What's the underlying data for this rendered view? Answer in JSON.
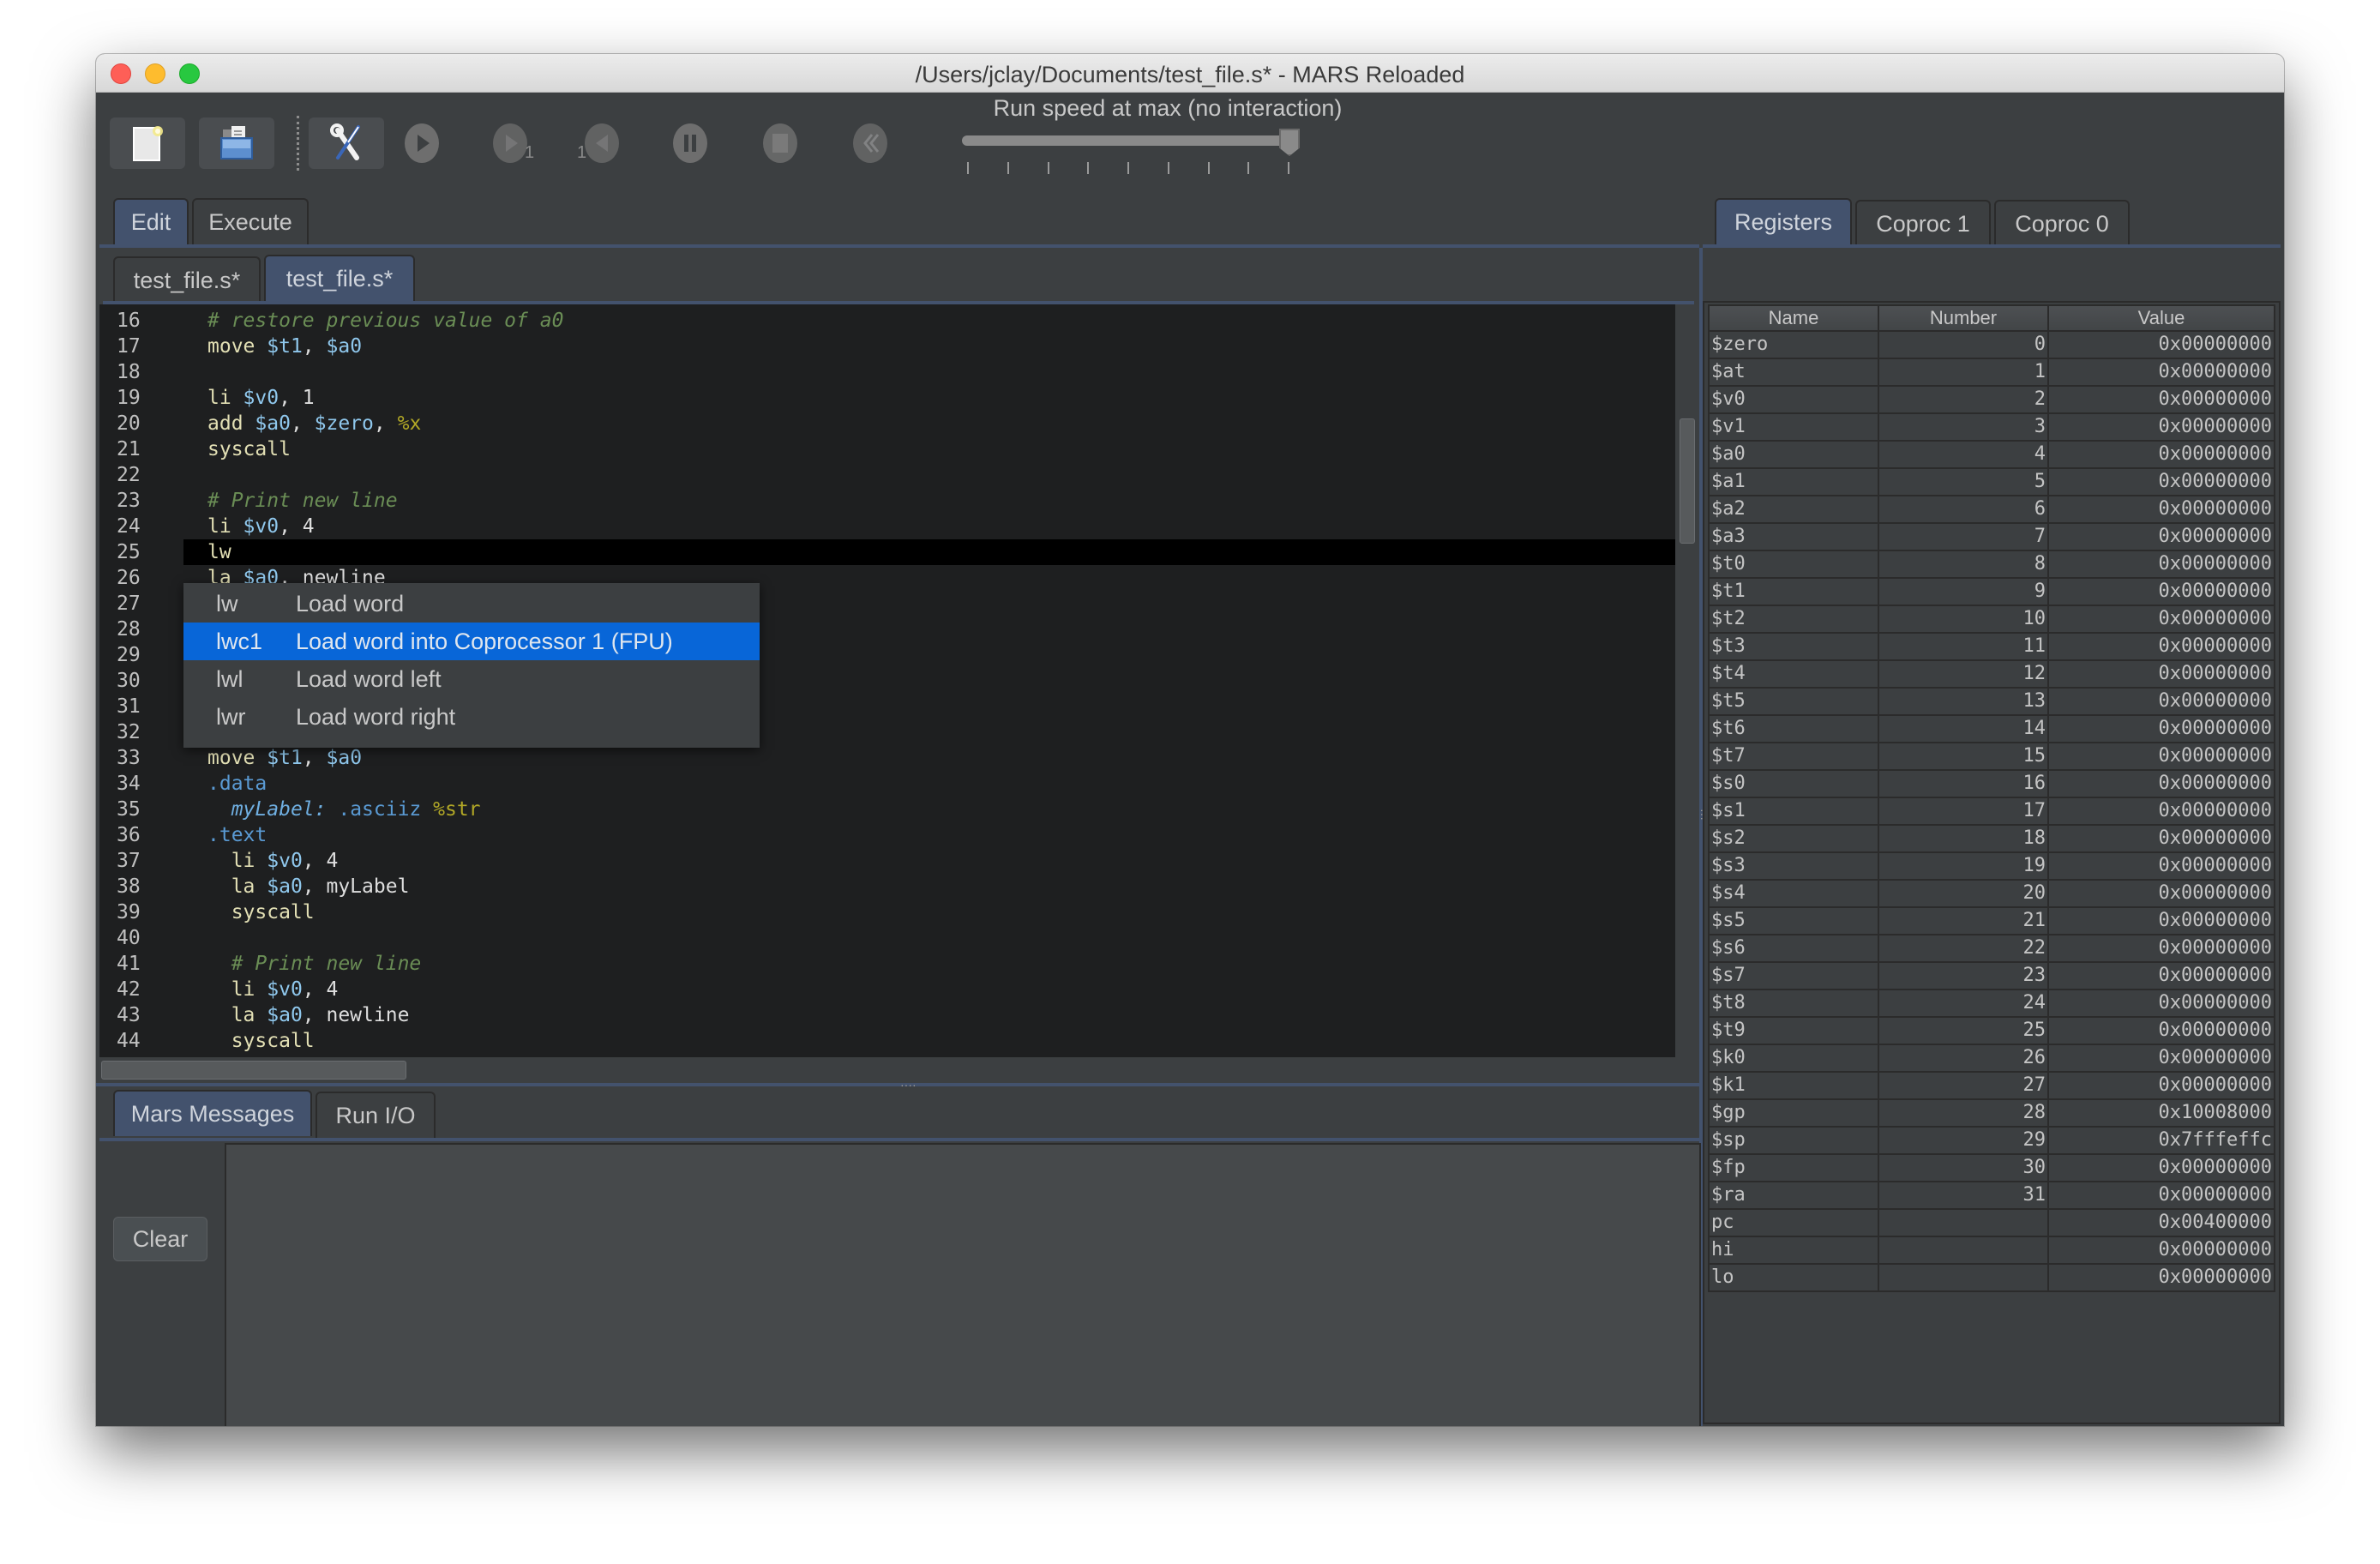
{
  "window": {
    "title": "/Users/jclay/Documents/test_file.s* - MARS Reloaded"
  },
  "toolbar": {
    "buttons": [
      {
        "name": "new-file",
        "icon": "new-file-icon",
        "enabled": true
      },
      {
        "name": "open-file",
        "icon": "open-folder-icon",
        "enabled": true
      },
      {
        "name": "assemble",
        "icon": "wrench-screwdriver-icon",
        "enabled": true
      },
      {
        "name": "run",
        "icon": "play-icon",
        "enabled": false
      },
      {
        "name": "step",
        "icon": "step-forward-icon",
        "enabled": false,
        "badge": "1"
      },
      {
        "name": "backstep",
        "icon": "step-back-icon",
        "enabled": false,
        "badge": "1"
      },
      {
        "name": "pause",
        "icon": "pause-icon",
        "enabled": false
      },
      {
        "name": "stop",
        "icon": "stop-icon",
        "enabled": false
      },
      {
        "name": "reset",
        "icon": "rewind-icon",
        "enabled": false
      }
    ],
    "speed_label": "Run speed at max (no interaction)",
    "speed_value_fraction": 1.0,
    "speed_ticks": 9
  },
  "main_tabs": {
    "items": [
      {
        "label": "Edit",
        "selected": true
      },
      {
        "label": "Execute",
        "selected": false
      }
    ]
  },
  "file_tabs": {
    "items": [
      {
        "label": "test_file.s*",
        "selected": false
      },
      {
        "label": "test_file.s*",
        "selected": true
      }
    ]
  },
  "editor": {
    "current_line": 25,
    "lines": [
      {
        "n": "16",
        "tokens": [
          {
            "t": "# restore previous value of a0",
            "c": "cmt"
          }
        ]
      },
      {
        "n": "17",
        "tokens": [
          {
            "t": "move ",
            "c": "ins"
          },
          {
            "t": "$t1",
            "c": "reg"
          },
          {
            "t": ", ",
            "c": "txt"
          },
          {
            "t": "$a0",
            "c": "reg"
          }
        ]
      },
      {
        "n": "18",
        "tokens": []
      },
      {
        "n": "19",
        "tokens": [
          {
            "t": "li ",
            "c": "ins"
          },
          {
            "t": "$v0",
            "c": "reg"
          },
          {
            "t": ", 1",
            "c": "txt"
          }
        ]
      },
      {
        "n": "20",
        "tokens": [
          {
            "t": "add ",
            "c": "ins"
          },
          {
            "t": "$a0",
            "c": "reg"
          },
          {
            "t": ", ",
            "c": "txt"
          },
          {
            "t": "$zero",
            "c": "reg"
          },
          {
            "t": ", ",
            "c": "txt"
          },
          {
            "t": "%x",
            "c": "mac"
          }
        ]
      },
      {
        "n": "21",
        "tokens": [
          {
            "t": "syscall",
            "c": "ins"
          }
        ]
      },
      {
        "n": "22",
        "tokens": []
      },
      {
        "n": "23",
        "tokens": [
          {
            "t": "# Print new line",
            "c": "cmt"
          }
        ]
      },
      {
        "n": "24",
        "tokens": [
          {
            "t": "li ",
            "c": "ins"
          },
          {
            "t": "$v0",
            "c": "reg"
          },
          {
            "t": ", 4",
            "c": "txt"
          }
        ]
      },
      {
        "n": "25",
        "tokens": [
          {
            "t": "lw",
            "c": "ins"
          }
        ]
      },
      {
        "n": "26",
        "tokens": [
          {
            "t": "la ",
            "c": "ins"
          },
          {
            "t": "$a0",
            "c": "reg"
          },
          {
            "t": ", newline",
            "c": "txt"
          }
        ]
      },
      {
        "n": "27",
        "tokens": []
      },
      {
        "n": "28",
        "tokens": []
      },
      {
        "n": "29",
        "tokens": []
      },
      {
        "n": "30",
        "tokens": []
      },
      {
        "n": "31",
        "tokens": []
      },
      {
        "n": "32",
        "tokens": []
      },
      {
        "n": "33",
        "tokens": [
          {
            "t": "move ",
            "c": "ins"
          },
          {
            "t": "$t1",
            "c": "reg"
          },
          {
            "t": ", ",
            "c": "txt"
          },
          {
            "t": "$a0",
            "c": "reg"
          }
        ]
      },
      {
        "n": "34",
        "tokens": [
          {
            "t": ".data",
            "c": "dir"
          }
        ]
      },
      {
        "n": "35",
        "tokens": [
          {
            "t": "  ",
            "c": "txt"
          },
          {
            "t": "myLabel:",
            "c": "lbl"
          },
          {
            "t": " ",
            "c": "txt"
          },
          {
            "t": ".asciiz",
            "c": "dir"
          },
          {
            "t": " ",
            "c": "txt"
          },
          {
            "t": "%str",
            "c": "mac"
          }
        ]
      },
      {
        "n": "36",
        "tokens": [
          {
            "t": ".text",
            "c": "dir"
          }
        ]
      },
      {
        "n": "37",
        "tokens": [
          {
            "t": "  li ",
            "c": "ins"
          },
          {
            "t": "$v0",
            "c": "reg"
          },
          {
            "t": ", 4",
            "c": "txt"
          }
        ]
      },
      {
        "n": "38",
        "tokens": [
          {
            "t": "  la ",
            "c": "ins"
          },
          {
            "t": "$a0",
            "c": "reg"
          },
          {
            "t": ", myLabel",
            "c": "txt"
          }
        ]
      },
      {
        "n": "39",
        "tokens": [
          {
            "t": "  syscall",
            "c": "ins"
          }
        ]
      },
      {
        "n": "40",
        "tokens": []
      },
      {
        "n": "41",
        "tokens": [
          {
            "t": "  ",
            "c": "txt"
          },
          {
            "t": "# Print new line",
            "c": "cmt"
          }
        ]
      },
      {
        "n": "42",
        "tokens": [
          {
            "t": "  li ",
            "c": "ins"
          },
          {
            "t": "$v0",
            "c": "reg"
          },
          {
            "t": ", 4",
            "c": "txt"
          }
        ]
      },
      {
        "n": "43",
        "tokens": [
          {
            "t": "  la ",
            "c": "ins"
          },
          {
            "t": "$a0",
            "c": "reg"
          },
          {
            "t": ", newline",
            "c": "txt"
          }
        ]
      },
      {
        "n": "44",
        "tokens": [
          {
            "t": "  syscall",
            "c": "ins"
          }
        ]
      }
    ]
  },
  "autocomplete": {
    "items": [
      {
        "key": "lw",
        "desc": "Load word",
        "selected": false
      },
      {
        "key": "lwc1",
        "desc": "Load word into Coprocessor 1 (FPU)",
        "selected": true
      },
      {
        "key": "lwl",
        "desc": "Load word left",
        "selected": false
      },
      {
        "key": "lwr",
        "desc": "Load word right",
        "selected": false
      }
    ]
  },
  "bottom_tabs": {
    "items": [
      {
        "label": "Mars Messages",
        "selected": true
      },
      {
        "label": "Run I/O",
        "selected": false
      }
    ],
    "clear_label": "Clear",
    "messages": ""
  },
  "register_tabs": {
    "items": [
      {
        "label": "Registers",
        "selected": true
      },
      {
        "label": "Coproc 1",
        "selected": false
      },
      {
        "label": "Coproc 0",
        "selected": false
      }
    ]
  },
  "registers": {
    "columns": [
      "Name",
      "Number",
      "Value"
    ],
    "rows": [
      [
        "$zero",
        "0",
        "0x00000000"
      ],
      [
        "$at",
        "1",
        "0x00000000"
      ],
      [
        "$v0",
        "2",
        "0x00000000"
      ],
      [
        "$v1",
        "3",
        "0x00000000"
      ],
      [
        "$a0",
        "4",
        "0x00000000"
      ],
      [
        "$a1",
        "5",
        "0x00000000"
      ],
      [
        "$a2",
        "6",
        "0x00000000"
      ],
      [
        "$a3",
        "7",
        "0x00000000"
      ],
      [
        "$t0",
        "8",
        "0x00000000"
      ],
      [
        "$t1",
        "9",
        "0x00000000"
      ],
      [
        "$t2",
        "10",
        "0x00000000"
      ],
      [
        "$t3",
        "11",
        "0x00000000"
      ],
      [
        "$t4",
        "12",
        "0x00000000"
      ],
      [
        "$t5",
        "13",
        "0x00000000"
      ],
      [
        "$t6",
        "14",
        "0x00000000"
      ],
      [
        "$t7",
        "15",
        "0x00000000"
      ],
      [
        "$s0",
        "16",
        "0x00000000"
      ],
      [
        "$s1",
        "17",
        "0x00000000"
      ],
      [
        "$s2",
        "18",
        "0x00000000"
      ],
      [
        "$s3",
        "19",
        "0x00000000"
      ],
      [
        "$s4",
        "20",
        "0x00000000"
      ],
      [
        "$s5",
        "21",
        "0x00000000"
      ],
      [
        "$s6",
        "22",
        "0x00000000"
      ],
      [
        "$s7",
        "23",
        "0x00000000"
      ],
      [
        "$t8",
        "24",
        "0x00000000"
      ],
      [
        "$t9",
        "25",
        "0x00000000"
      ],
      [
        "$k0",
        "26",
        "0x00000000"
      ],
      [
        "$k1",
        "27",
        "0x00000000"
      ],
      [
        "$gp",
        "28",
        "0x10008000"
      ],
      [
        "$sp",
        "29",
        "0x7fffeffc"
      ],
      [
        "$fp",
        "30",
        "0x00000000"
      ],
      [
        "$ra",
        "31",
        "0x00000000"
      ],
      [
        "pc",
        "",
        "0x00400000"
      ],
      [
        "hi",
        "",
        "0x00000000"
      ],
      [
        "lo",
        "",
        "0x00000000"
      ]
    ]
  },
  "colors": {
    "selection": "#0866d8",
    "tab_selected": "#43526d",
    "editor_bg": "#1e1f20",
    "current_line": "#000000"
  }
}
